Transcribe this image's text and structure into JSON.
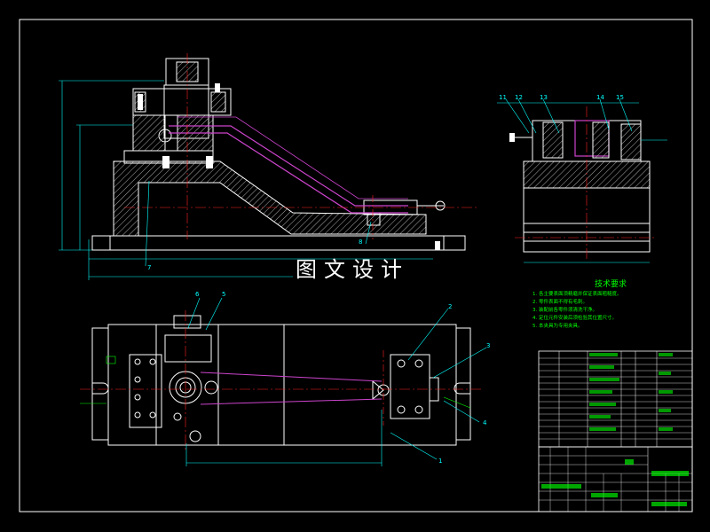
{
  "watermark": "图文设计",
  "tech_requirements": {
    "title": "技术要求",
    "items": [
      "1. 各主要表面须精磨并保证表面粗糙度。",
      "2. 零件表面不得有毛刺。",
      "3. 装配前各零件须清洗干净。",
      "4. 定位元件安装后须检验其位置尺寸。",
      "5. 本夹具为专用夹具。"
    ]
  },
  "callouts": {
    "front": [
      "7",
      "8"
    ],
    "side": [
      "11",
      "12",
      "13",
      "14",
      "15"
    ],
    "plan": [
      "6",
      "5",
      "2",
      "3",
      "4",
      "1"
    ]
  },
  "colors": {
    "outline": "#ffffff",
    "dimension": "#00ffff",
    "center": "#ff2222",
    "path": "#cc44cc",
    "hatch": "#bbbbbb",
    "text": "#00ff00",
    "table": "#ffffff",
    "yellow": "#ffff00"
  }
}
